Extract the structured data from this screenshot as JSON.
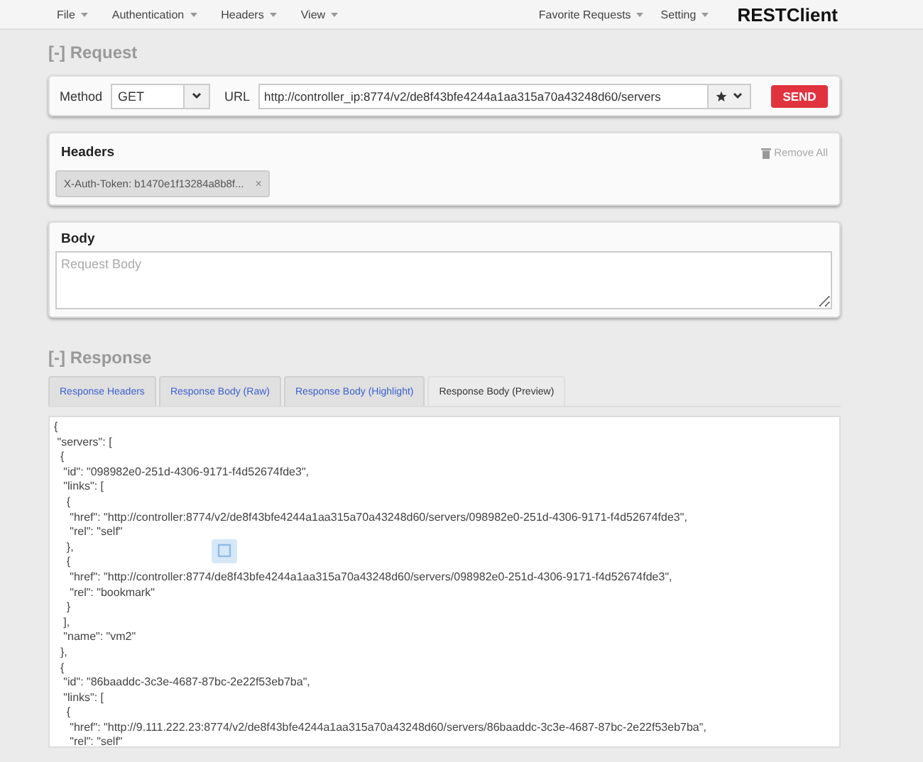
{
  "menu": {
    "left": [
      "File",
      "Authentication",
      "Headers",
      "View"
    ],
    "right": [
      "Favorite Requests",
      "Setting"
    ],
    "brand": "RESTClient"
  },
  "request": {
    "title": "[-] Request",
    "method_label": "Method",
    "method": "GET",
    "url_label": "URL",
    "url": "http://controller_ip:8774/v2/de8f43bfe4244a1aa315a70a43248d60/servers",
    "send": "SEND",
    "headers": {
      "title": "Headers",
      "remove_all": "Remove All",
      "items": [
        {
          "text": "X-Auth-Token: b1470e1f13284a8b8f...",
          "remove": "×"
        }
      ]
    },
    "body": {
      "title": "Body",
      "placeholder": "Request Body"
    }
  },
  "response": {
    "title": "[-] Response",
    "tabs": [
      {
        "label": "Response Headers",
        "selected": false
      },
      {
        "label": "Response Body (Raw)",
        "selected": false
      },
      {
        "label": "Response Body (Highlight)",
        "selected": false
      },
      {
        "label": "Response Body (Preview)",
        "selected": true
      }
    ],
    "lines": [
      "{",
      " \"servers\": [",
      "  {",
      "   \"id\": \"098982e0-251d-4306-9171-f4d52674fde3\",",
      "   \"links\": [",
      "    {",
      "     \"href\": \"http://controller:8774/v2/de8f43bfe4244a1aa315a70a43248d60/servers/098982e0-251d-4306-9171-f4d52674fde3\",",
      "     \"rel\": \"self\"",
      "    },",
      "    {",
      "     \"href\": \"http://controller:8774/de8f43bfe4244a1aa315a70a43248d60/servers/098982e0-251d-4306-9171-f4d52674fde3\",",
      "     \"rel\": \"bookmark\"",
      "    }",
      "   ],",
      "   \"name\": \"vm2\"",
      "  },",
      "  {",
      "   \"id\": \"86baaddc-3c3e-4687-87bc-2e22f53eb7ba\",",
      "   \"links\": [",
      "    {",
      "     \"href\": \"http://9.111.222.23:8774/v2/de8f43bfe4244a1aa315a70a43248d60/servers/86baaddc-3c3e-4687-87bc-2e22f53eb7ba\",",
      "     \"rel\": \"self\""
    ]
  }
}
